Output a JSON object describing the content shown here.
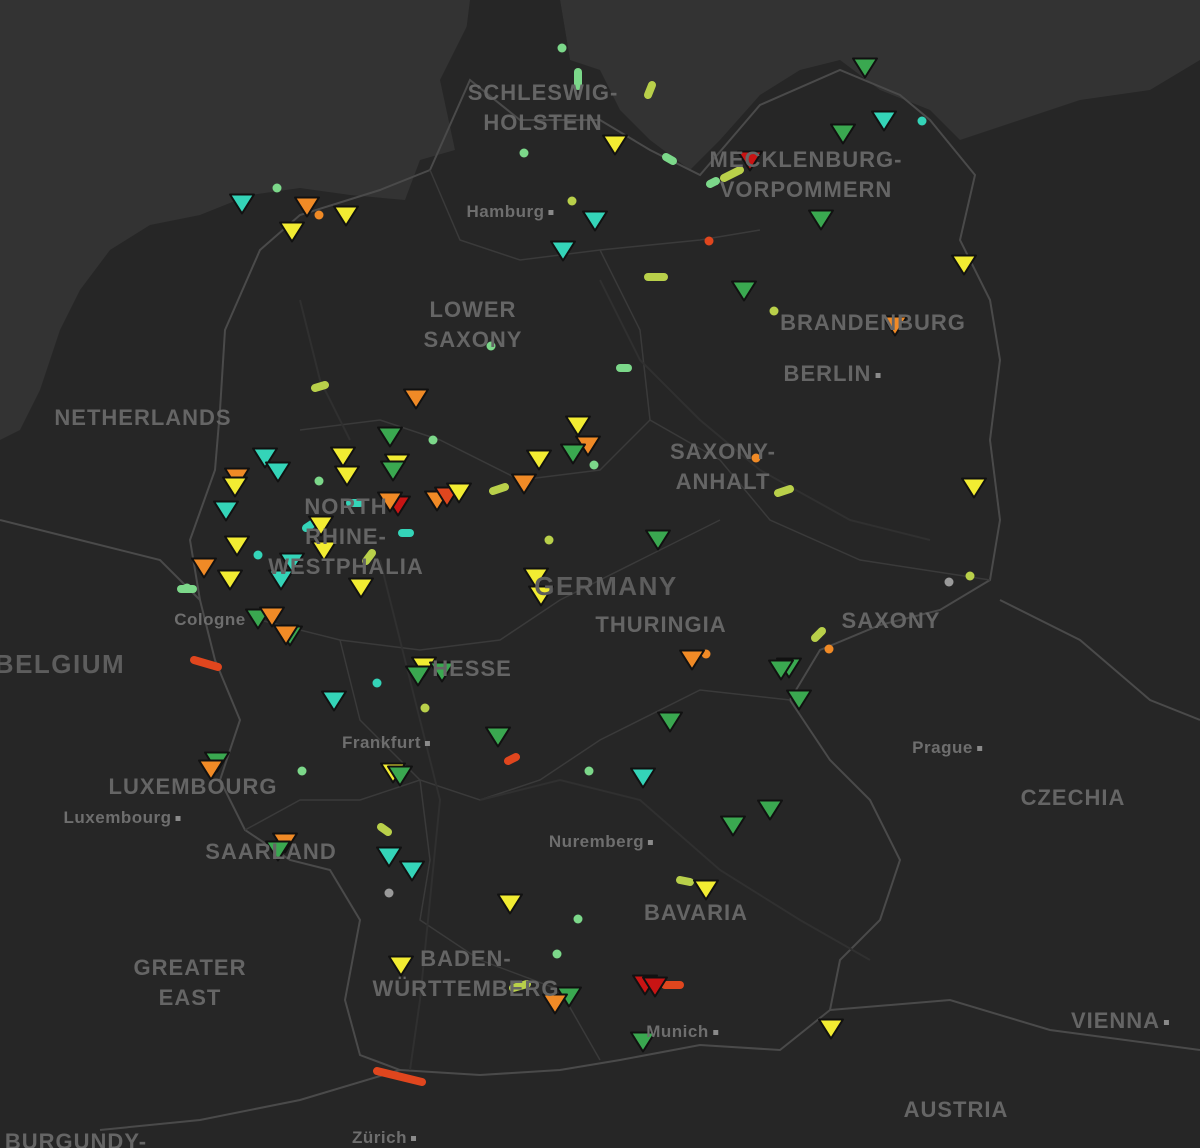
{
  "map": {
    "colors": {
      "sea": "#333333",
      "land": "#262626",
      "border": "#4a4a4a",
      "river": "#303030",
      "label": "#6a6a6a",
      "marker_outline": "#111111",
      "red": "#c81414",
      "red_orange": "#e0461e",
      "orange": "#f08a26",
      "yellow": "#f2ec32",
      "yellow_green": "#b9d04a",
      "green": "#3aa850",
      "turquoise": "#34d4b8",
      "gray": "#9a9a9a",
      "lime": "#7cd88a"
    },
    "labels": [
      {
        "id": "schleswig-holstein",
        "text": "SCHLESWIG-\nHOLSTEIN",
        "kind": "region"
      },
      {
        "id": "mecklenburg-vorpommern",
        "text": "MECKLENBURG-\nVORPOMMERN",
        "kind": "region"
      },
      {
        "id": "hamburg",
        "text": "Hamburg",
        "kind": "city"
      },
      {
        "id": "lower-saxony",
        "text": "LOWER\nSAXONY",
        "kind": "region"
      },
      {
        "id": "brandenburg",
        "text": "BRANDENBURG",
        "kind": "region"
      },
      {
        "id": "berlin",
        "text": "BERLIN",
        "kind": "region"
      },
      {
        "id": "netherlands",
        "text": "NETHERLANDS",
        "kind": "region"
      },
      {
        "id": "saxony-anhalt",
        "text": "SAXONY-\nANHALT",
        "kind": "region"
      },
      {
        "id": "north-rhine-westphalia",
        "text": "NORTH\nRHINE-\nWESTPHALIA",
        "kind": "region"
      },
      {
        "id": "germany",
        "text": "GERMANY",
        "kind": "country"
      },
      {
        "id": "thuringia",
        "text": "THURINGIA",
        "kind": "region"
      },
      {
        "id": "saxony",
        "text": "SAXONY",
        "kind": "region"
      },
      {
        "id": "cologne",
        "text": "Cologne",
        "kind": "city"
      },
      {
        "id": "belgium",
        "text": "BELGIUM",
        "kind": "country"
      },
      {
        "id": "hesse",
        "text": "HESSE",
        "kind": "region"
      },
      {
        "id": "frankfurt",
        "text": "Frankfurt",
        "kind": "city"
      },
      {
        "id": "prague",
        "text": "Prague",
        "kind": "city"
      },
      {
        "id": "luxembourg-country",
        "text": "LUXEMBOURG",
        "kind": "region"
      },
      {
        "id": "czechia",
        "text": "CZECHIA",
        "kind": "region"
      },
      {
        "id": "luxembourg-city",
        "text": "Luxembourg",
        "kind": "city"
      },
      {
        "id": "nuremberg",
        "text": "Nuremberg",
        "kind": "city"
      },
      {
        "id": "saarland",
        "text": "SAARLAND",
        "kind": "region"
      },
      {
        "id": "bavaria",
        "text": "BAVARIA",
        "kind": "region"
      },
      {
        "id": "greater-east",
        "text": "GREATER\nEAST",
        "kind": "region"
      },
      {
        "id": "baden-wurttemberg",
        "text": "BADEN-\nWÜRTTEMBERG",
        "kind": "region"
      },
      {
        "id": "munich",
        "text": "Munich",
        "kind": "city"
      },
      {
        "id": "vienna",
        "text": "VIENNA",
        "kind": "region"
      },
      {
        "id": "austria",
        "text": "AUSTRIA",
        "kind": "region"
      },
      {
        "id": "burgundy",
        "text": "BURGUNDY-",
        "kind": "region"
      },
      {
        "id": "zurich",
        "text": "Zürich",
        "kind": "city"
      }
    ]
  }
}
